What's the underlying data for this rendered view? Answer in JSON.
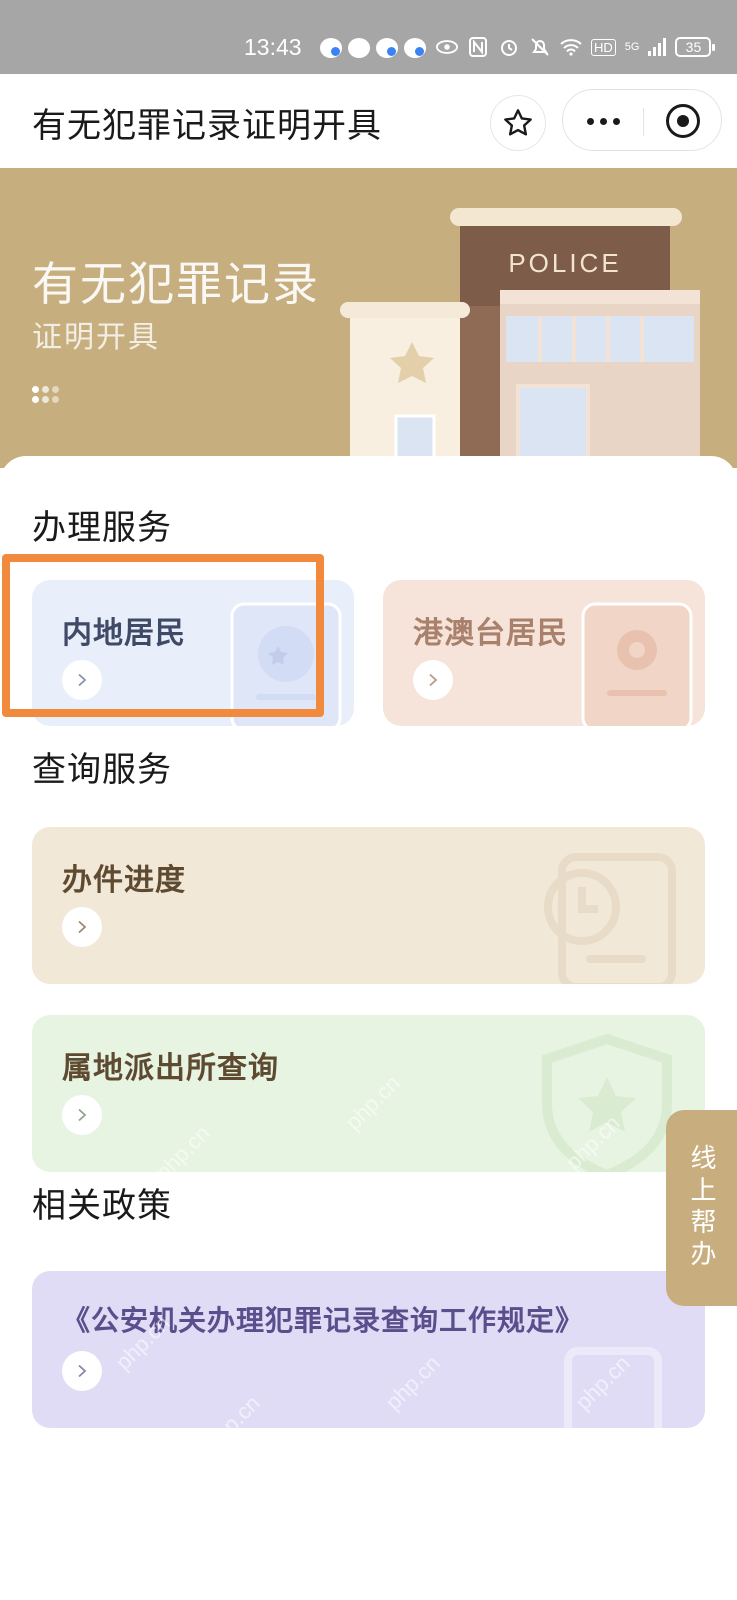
{
  "status_bar": {
    "time": "13:43",
    "network": "5G",
    "hd": "HD",
    "battery": "35"
  },
  "header": {
    "title": "有无犯罪记录证明开具"
  },
  "banner": {
    "title": "有无犯罪记录",
    "subtitle": "证明开具",
    "sign": "POLICE"
  },
  "sections": {
    "handle": {
      "title": "办理服务",
      "cards": [
        {
          "label": "内地居民",
          "color": "#e9eefb",
          "text_color": "#3e4a66"
        },
        {
          "label": "港澳台居民",
          "color": "#f6e3d9",
          "text_color": "#a8806b"
        }
      ]
    },
    "query": {
      "title": "查询服务",
      "cards": [
        {
          "label": "办件进度",
          "color": "#f2e8d8",
          "text_color": "#5e4a30"
        },
        {
          "label": "属地派出所查询",
          "color": "#e7f4e2",
          "text_color": "#5e4a30"
        }
      ]
    },
    "policy": {
      "title": "相关政策",
      "cards": [
        {
          "label": "《公安机关办理犯罪记录查询工作规定》",
          "color": "#e1dcf5",
          "text_color": "#5a4e8c"
        }
      ]
    }
  },
  "floating_help": {
    "label": "线上帮办"
  },
  "watermark": "php.cn",
  "colors": {
    "banner_bg": "#c7ae7e",
    "highlight": "#f28a3d",
    "float_help_bg": "#c8ad7f"
  }
}
